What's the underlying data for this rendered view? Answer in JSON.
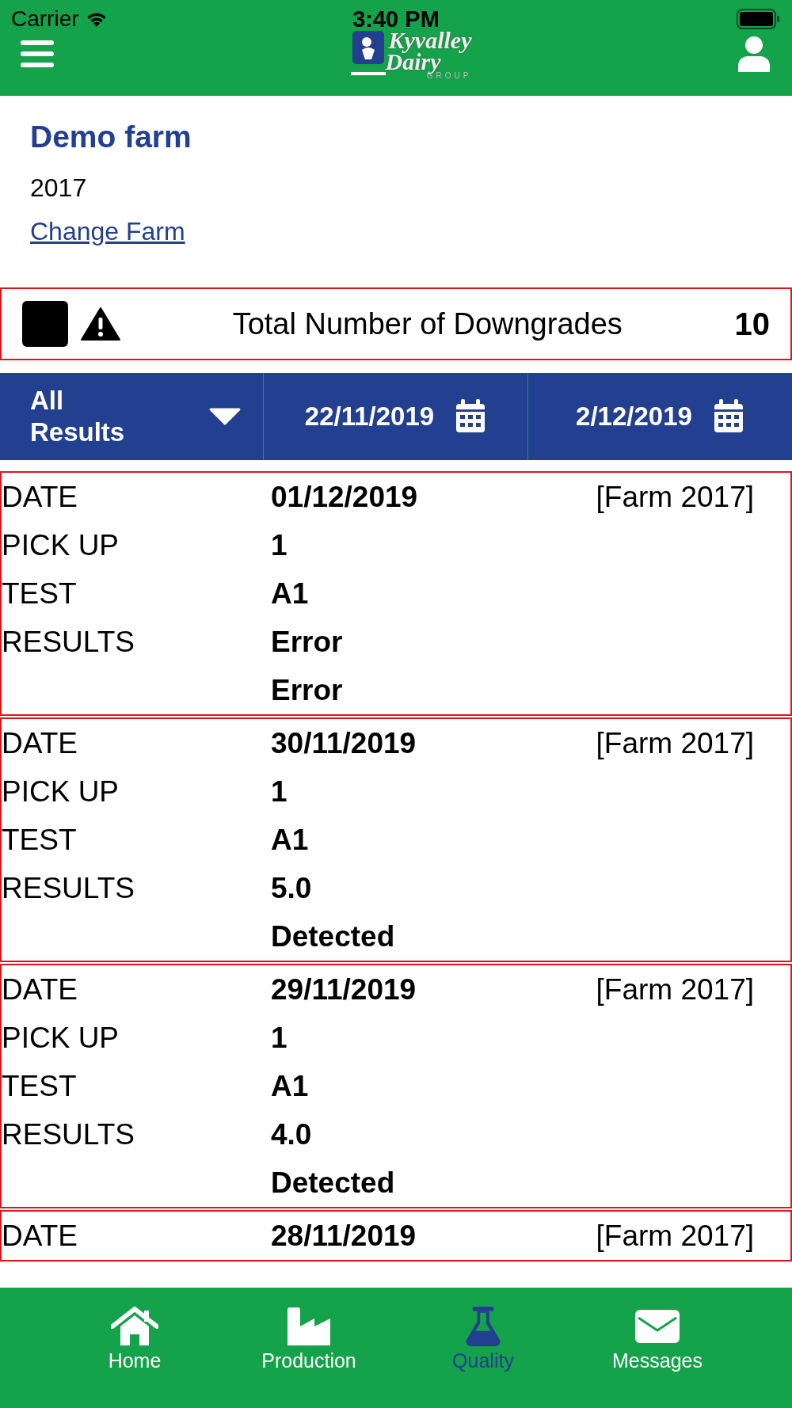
{
  "status_bar": {
    "carrier": "Carrier",
    "time": "3:40 PM"
  },
  "header": {
    "logo": {
      "line1": "Kyvalley",
      "line2": "Dairy",
      "line3": "GROUP"
    }
  },
  "farm": {
    "name": "Demo farm",
    "number": "2017",
    "change_link": "Change Farm"
  },
  "downgrades": {
    "label": "Total Number of Downgrades",
    "count": "10"
  },
  "filters": {
    "dropdown": "All Results",
    "start_date": "22/11/2019",
    "end_date": "2/12/2019"
  },
  "records": [
    {
      "date_label": "DATE",
      "date": "01/12/2019",
      "farm": "[Farm 2017]",
      "pickup_label": "PICK UP",
      "pickup": "1",
      "test_label": "TEST",
      "test": "A1",
      "results_label": "RESULTS",
      "results": [
        "Error",
        "Error"
      ]
    },
    {
      "date_label": "DATE",
      "date": "30/11/2019",
      "farm": "[Farm 2017]",
      "pickup_label": "PICK UP",
      "pickup": "1",
      "test_label": "TEST",
      "test": "A1",
      "results_label": "RESULTS",
      "results": [
        "5.0",
        "Detected"
      ]
    },
    {
      "date_label": "DATE",
      "date": "29/11/2019",
      "farm": "[Farm 2017]",
      "pickup_label": "PICK UP",
      "pickup": "1",
      "test_label": "TEST",
      "test": "A1",
      "results_label": "RESULTS",
      "results": [
        "4.0",
        "Detected"
      ]
    },
    {
      "date_label": "DATE",
      "date": "28/11/2019",
      "farm": "[Farm 2017]"
    }
  ],
  "tabs": [
    {
      "label": "Home",
      "kind": "home",
      "selected": false
    },
    {
      "label": "Production",
      "kind": "factory",
      "selected": false
    },
    {
      "label": "Quality",
      "kind": "flask",
      "selected": true
    },
    {
      "label": "Messages",
      "kind": "mail",
      "selected": false
    }
  ]
}
